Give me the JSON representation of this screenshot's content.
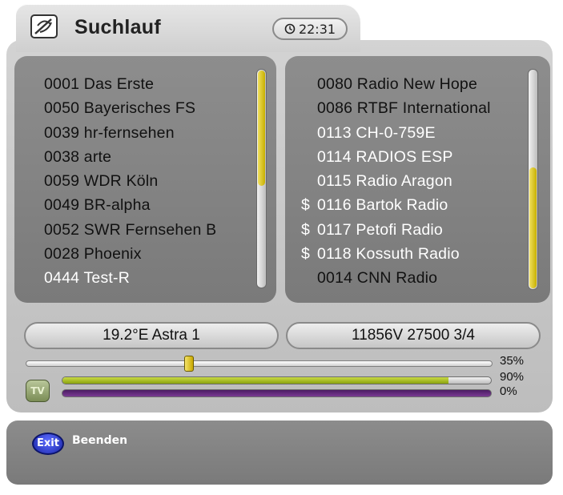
{
  "header": {
    "title": "Suchlauf",
    "time": "22:31"
  },
  "channels_left": {
    "items": [
      {
        "label": "0001 Das Erste"
      },
      {
        "label": "0050 Bayerisches FS"
      },
      {
        "label": "0039 hr-fernsehen"
      },
      {
        "label": "0038 arte"
      },
      {
        "label": "0059 WDR Köln"
      },
      {
        "label": "0049 BR-alpha"
      },
      {
        "label": "0052 SWR Fernsehen B"
      },
      {
        "label": "0028 Phoenix"
      },
      {
        "label": "0444 Test-R"
      }
    ],
    "scroll_position": 0.0,
    "scroll_visible_fraction": 0.53
  },
  "channels_right": {
    "items": [
      {
        "prefix": "",
        "label": "0080 Radio New Hope"
      },
      {
        "prefix": "",
        "label": "0086 RTBF International"
      },
      {
        "prefix": "",
        "label": "0113 CH-0-759E"
      },
      {
        "prefix": "",
        "label": "0114 RADIOS ESP"
      },
      {
        "prefix": "",
        "label": "0115 Radio Aragon"
      },
      {
        "prefix": "$",
        "label": "0116 Bartok Radio"
      },
      {
        "prefix": "$",
        "label": "0117 Petofi Radio"
      },
      {
        "prefix": "$",
        "label": "0118 Kossuth Radio"
      },
      {
        "prefix": "",
        "label": "0014 CNN Radio"
      }
    ],
    "scroll_position": 1.0,
    "scroll_visible_fraction": 0.55
  },
  "tuning": {
    "satellite": "19.2°E Astra 1",
    "transponder": "11856V 27500 3/4"
  },
  "progress": {
    "value": 0.35,
    "label": "35%"
  },
  "signal": {
    "icon": "signal-tv-icon",
    "icon_text": "TV",
    "strength": 0.9,
    "strength_label": "90%",
    "error_rate": 0.0,
    "error_label": "0%"
  },
  "help": {
    "exit_button": "Exit",
    "exit_label": "Beenden"
  },
  "colors": {
    "scroll_thumb": "#d8c200",
    "signal_fill": "#a9bf22",
    "ber_bar": "#5a2a74",
    "exit_button": "#2a35c8"
  }
}
